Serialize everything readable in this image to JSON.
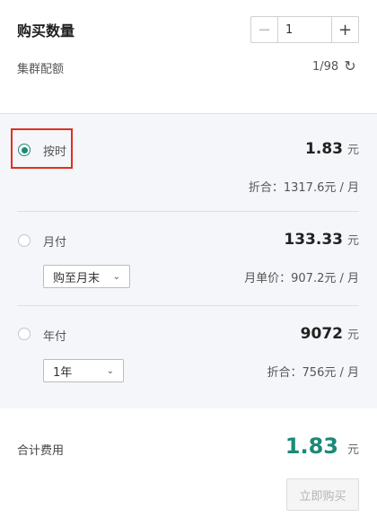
{
  "header": {
    "title": "购买数量",
    "quantity": "1",
    "minus_symbol": "−",
    "plus_symbol": "+",
    "subtitle": "集群配额",
    "quota": "1/98",
    "refresh_icon": "↻"
  },
  "options": [
    {
      "label": "按时",
      "selected": true,
      "price": "1.83",
      "unit": "元",
      "note": "折合：1317.6元 / 月"
    },
    {
      "label": "月付",
      "selected": false,
      "price": "133.33",
      "unit": "元",
      "select_value": "购至月末",
      "note": "月单价：907.2元 / 月"
    },
    {
      "label": "年付",
      "selected": false,
      "price": "9072",
      "unit": "元",
      "select_value": "1年",
      "note": "折合：756元 / 月"
    }
  ],
  "footer": {
    "total_label": "合计费用",
    "total_price": "1.83",
    "total_unit": "元",
    "buy_label": "立即购买"
  },
  "icons": {
    "chevron": "⌄"
  },
  "colors": {
    "accent": "#1b8a77",
    "highlight_border": "#e0301e",
    "panel_bg": "#f5f6fa"
  }
}
